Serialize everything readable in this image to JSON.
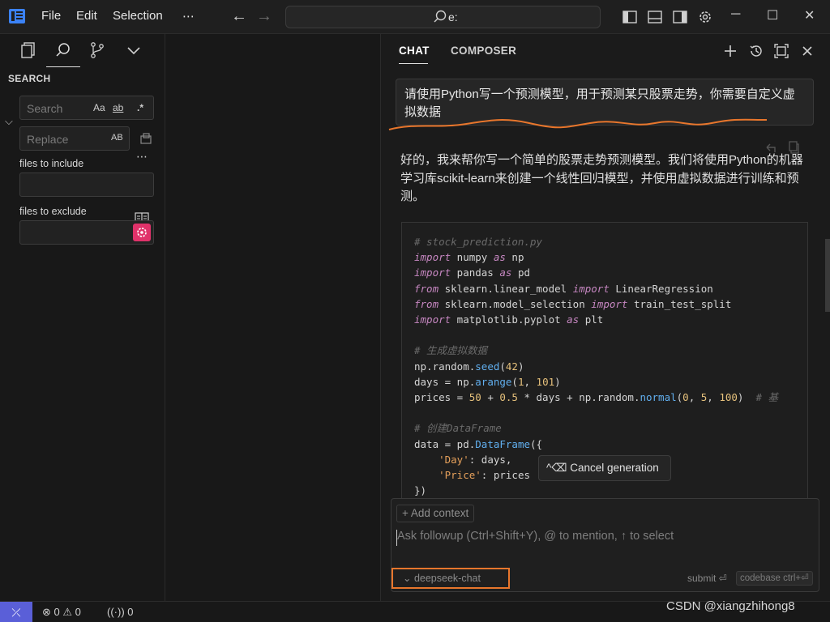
{
  "titlebar": {
    "menu": [
      "File",
      "Edit",
      "Selection"
    ],
    "more": "⋯",
    "search_text": "e:"
  },
  "sidebar": {
    "title": "SEARCH",
    "search_placeholder": "Search",
    "replace_placeholder": "Replace",
    "opt_case": "Aa",
    "opt_word": "ab",
    "opt_regex": ".*",
    "opt_preserve_case": "AB",
    "more": "⋯",
    "files_include_label": "files to include",
    "files_exclude_label": "files to exclude"
  },
  "chat": {
    "tabs": [
      "CHAT",
      "COMPOSER"
    ],
    "user_message": "请使用Python写一个预测模型，用于预测某只股票走势，你需要自定义虚拟数据",
    "assistant_text": "好的，我来帮你写一个简单的股票走势预测模型。我们将使用Python的机器学习库scikit-learn来创建一个线性回归模型，并使用虚拟数据进行训练和预测。",
    "cancel_label": "Cancel generation",
    "cancel_shortcut": "^⌫",
    "add_context": "Add context",
    "followup_placeholder": "Ask followup (Ctrl+Shift+Y), @ to mention, ↑ to select",
    "model": "deepseek-chat",
    "submit_label": "submit ⏎",
    "codebase_label": "codebase ctrl+⏎"
  },
  "code_lines": [
    "# stock_prediction.py",
    "import numpy as np",
    "import pandas as pd",
    "from sklearn.linear_model import LinearRegression",
    "from sklearn.model_selection import train_test_split",
    "import matplotlib.pyplot as plt",
    "",
    "# 生成虚拟数据",
    "np.random.seed(42)",
    "days = np.arange(1, 101)",
    "prices = 50 + 0.5 * days + np.random.normal(0, 5, 100)  # 基",
    "",
    "# 创建DataFrame",
    "data = pd.DataFrame({",
    "    'Day': days,",
    "    'Price': prices",
    "})"
  ],
  "status": {
    "errors": "0",
    "warnings": "0",
    "ports": "0",
    "watermark": "CSDN @xiangzhihong8"
  },
  "colors": {
    "accent": "#5a5fd8",
    "highlight": "#e8762c",
    "exclude_btn": "#e0326a"
  }
}
